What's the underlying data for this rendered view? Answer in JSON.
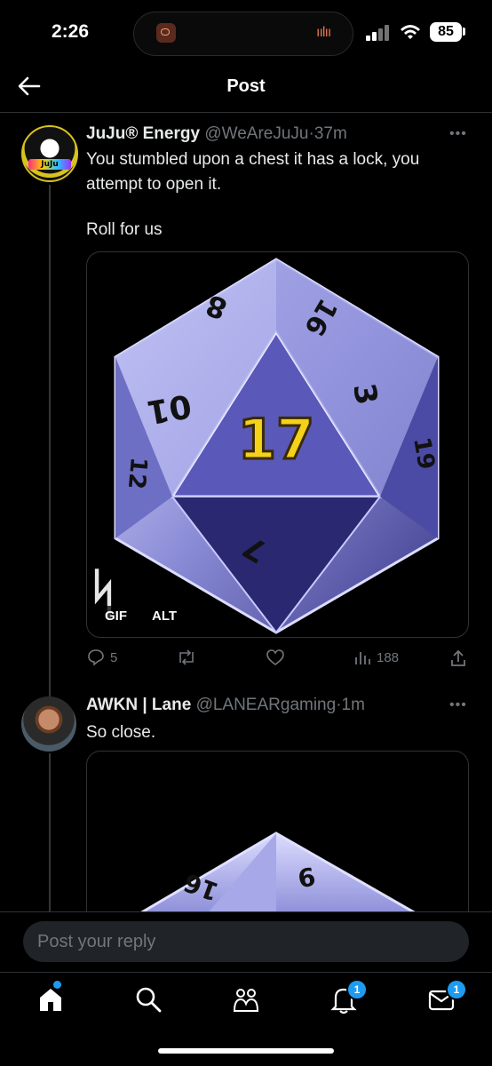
{
  "status_bar": {
    "time": "2:26",
    "battery": "85"
  },
  "header": {
    "title": "Post"
  },
  "post": {
    "author_name": "JuJu® Energy",
    "handle": "@WeAreJuJu",
    "separator": "·",
    "age": "37m",
    "text_line1": "You stumbled upon a chest it has a lock, you",
    "text_line2": "attempt to open it.",
    "text_line3": "Roll for us",
    "avatar_badge": "JuJu",
    "media": {
      "die_top_number": "17",
      "gif_label": "GIF",
      "alt_label": "ALT"
    },
    "actions": {
      "replies": "5",
      "reposts": "",
      "likes": "",
      "views": "188"
    }
  },
  "reply": {
    "author_name": "AWKN | Lane",
    "handle": "@LANEARgaming",
    "separator": "·",
    "age": "1m",
    "text": "So close."
  },
  "reply_box": {
    "placeholder": "Post your reply"
  },
  "tab_bar": {
    "notifications_count": "1",
    "messages_count": "1"
  },
  "colors": {
    "accent": "#1d9bf0",
    "background": "#000000",
    "muted": "#71767b"
  }
}
